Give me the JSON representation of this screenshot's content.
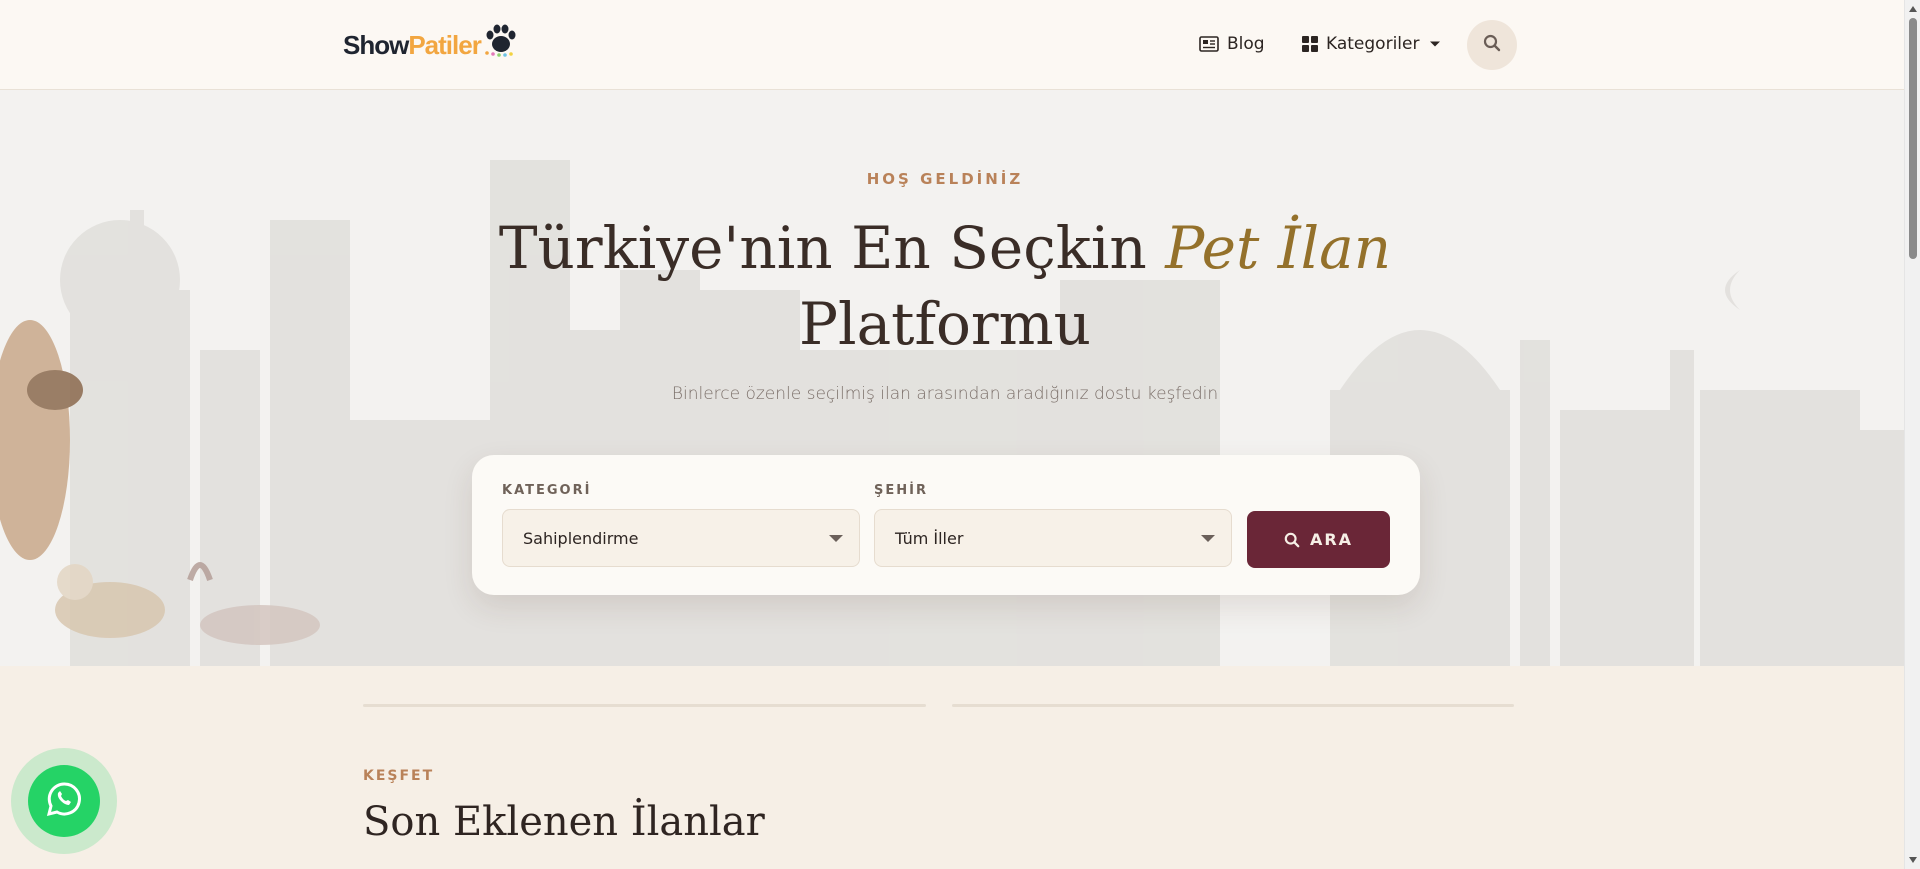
{
  "header": {
    "logo": {
      "part1": "Show",
      "part2": "Patiler"
    },
    "nav": {
      "blog_label": "Blog",
      "categories_label": "Kategoriler"
    }
  },
  "hero": {
    "kicker": "HOŞ GELDİNİZ",
    "title_part1": "Türkiye'nin En Seçkin ",
    "title_accent": "Pet İlan",
    "title_part2": "Platformu",
    "subtitle": "Binlerce özenle seçilmiş ilan arasından aradığınız dostu keşfedin"
  },
  "search": {
    "category_label": "KATEGORİ",
    "category_value": "Sahiplendirme",
    "city_label": "ŞEHİR",
    "city_value": "Tüm İller",
    "button_label": "ARA"
  },
  "section": {
    "kicker": "KEŞFET",
    "title": "Son Eklenen İlanlar"
  },
  "colors": {
    "brand_dark": "#6a2637",
    "accent_gold": "#94712b",
    "kicker": "#b98259",
    "whatsapp": "#25d366",
    "logo_orange": "#f2a640"
  },
  "icons": {
    "logo": "paw-icon",
    "blog": "newspaper-icon",
    "categories": "grid-icon",
    "search": "search-icon",
    "chat": "whatsapp-icon"
  }
}
